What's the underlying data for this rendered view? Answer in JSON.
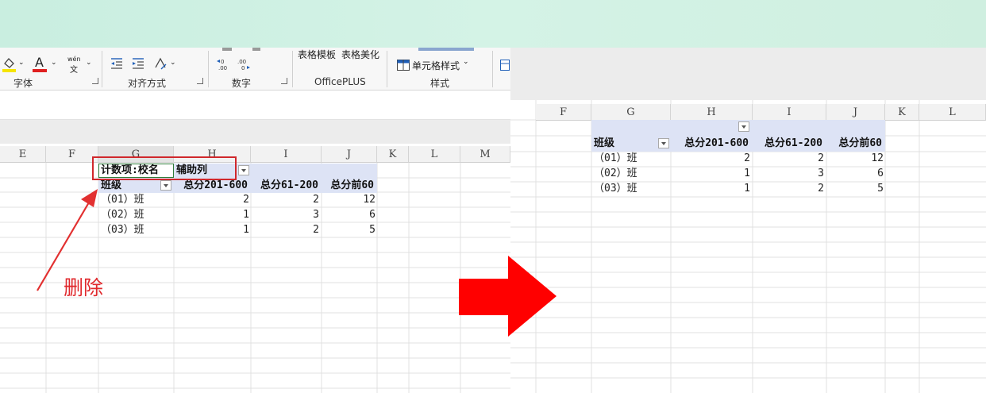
{
  "ribbon": {
    "groups": {
      "font": "字体",
      "align": "对齐方式",
      "number": "数字",
      "officeplus": "OfficePLUS",
      "styles": "样式"
    },
    "buttons": {
      "table_template": "表格模板",
      "table_beautify": "表格美化",
      "cell_styles": "单元格样式",
      "phonetic_top": "wén",
      "phonetic_bottom": "文",
      "font_color_letter": "A",
      "increase_decimal": "←0 .00",
      "decrease_decimal": ".00 →0"
    }
  },
  "left_sheet": {
    "columns": [
      "E",
      "F",
      "G",
      "H",
      "I",
      "J",
      "K",
      "L",
      "M"
    ],
    "pivot": {
      "filter_label": "计数项:校名",
      "aux_label": "辅助列",
      "row_header": "班级",
      "headers": [
        "总分201-600",
        "总分61-200",
        "总分前60"
      ],
      "rows": [
        {
          "label": "（01）班",
          "values": [
            "2",
            "2",
            "12"
          ]
        },
        {
          "label": "（02）班",
          "values": [
            "1",
            "3",
            "6"
          ]
        },
        {
          "label": "（03）班",
          "values": [
            "1",
            "2",
            "5"
          ]
        }
      ]
    },
    "annotation": "删除",
    "colors": {
      "highlight": "#d0282c",
      "arrow": "#e23030"
    }
  },
  "right_sheet": {
    "columns": [
      "F",
      "G",
      "H",
      "I",
      "J",
      "K",
      "L"
    ],
    "pivot": {
      "row_header": "班级",
      "headers": [
        "总分201-600",
        "总分61-200",
        "总分前60"
      ],
      "rows": [
        {
          "label": "（01）班",
          "values": [
            "2",
            "2",
            "12"
          ]
        },
        {
          "label": "（02）班",
          "values": [
            "1",
            "3",
            "6"
          ]
        },
        {
          "label": "（03）班",
          "values": [
            "1",
            "2",
            "5"
          ]
        }
      ]
    }
  },
  "big_arrow": {
    "color": "#ff0000"
  }
}
